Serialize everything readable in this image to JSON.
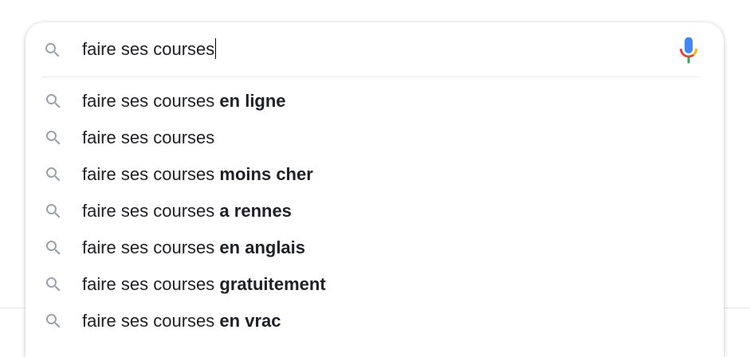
{
  "search": {
    "query": "faire ses courses",
    "icon": "search-icon",
    "voice_icon": "microphone-icon"
  },
  "suggestions": [
    {
      "prefix": "faire ses courses",
      "completion": "en ligne"
    },
    {
      "prefix": "faire ses courses",
      "completion": ""
    },
    {
      "prefix": "faire ses courses",
      "completion": "moins cher"
    },
    {
      "prefix": "faire ses courses",
      "completion": "a rennes"
    },
    {
      "prefix": "faire ses courses",
      "completion": "en anglais"
    },
    {
      "prefix": "faire ses courses",
      "completion": "gratuitement"
    },
    {
      "prefix": "faire ses courses",
      "completion": "en vrac"
    }
  ],
  "colors": {
    "text": "#202124",
    "icon": "#9aa0a6",
    "mic_blue": "#4285f4",
    "mic_red": "#ea4335",
    "mic_yellow": "#fbbc04",
    "mic_green": "#34a853"
  }
}
